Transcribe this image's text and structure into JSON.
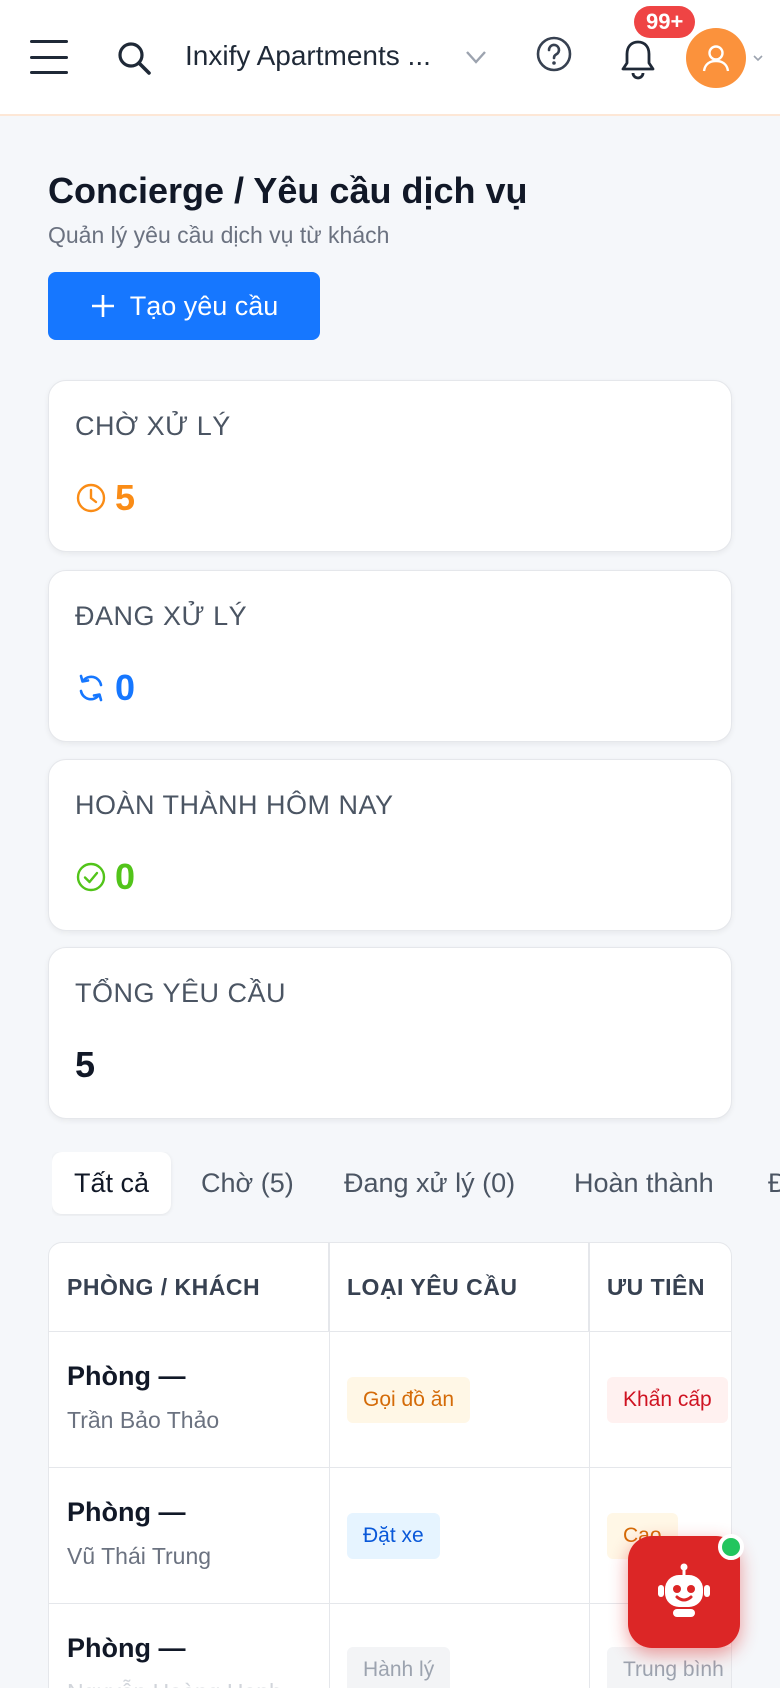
{
  "header": {
    "tenant_name": "Inxify Apartments ...",
    "notification_count": "99+"
  },
  "page": {
    "title": "Concierge / Yêu cầu dịch vụ",
    "subtitle": "Quản lý yêu cầu dịch vụ từ khách",
    "create_button_label": "Tạo yêu cầu"
  },
  "stats": [
    {
      "label": "CHỜ XỬ LÝ",
      "value": "5",
      "icon": "clock-icon",
      "color": "#fa8c16"
    },
    {
      "label": "ĐANG XỬ LÝ",
      "value": "0",
      "icon": "sync-icon",
      "color": "#1677ff"
    },
    {
      "label": "HOÀN THÀNH HÔM NAY",
      "value": "0",
      "icon": "check-circle-icon",
      "color": "#52c41a"
    },
    {
      "label": "TỔNG YÊU CẦU",
      "value": "5",
      "icon": "",
      "color": "#111827"
    }
  ],
  "tabs": [
    {
      "label": "Tất cả",
      "active": true
    },
    {
      "label": "Chờ (5)"
    },
    {
      "label": "Đang xử lý (0)"
    },
    {
      "label": "Hoàn thành"
    },
    {
      "label": "Đ"
    }
  ],
  "table": {
    "columns": [
      "PHÒNG / KHÁCH",
      "LOẠI YÊU CẦU",
      "ƯU TIÊN"
    ],
    "rows": [
      {
        "room": "Phòng —",
        "guest": "Trần Bảo Thảo",
        "type": "Gọi đồ ăn",
        "priority": "Khẩn cấp"
      },
      {
        "room": "Phòng —",
        "guest": "Vũ Thái Trung",
        "type": "Đặt xe",
        "priority": "Cao"
      },
      {
        "room": "Phòng —",
        "guest": "Nguyễn Hoàng Hạnh",
        "type": "Hành lý",
        "priority": "Trung bình"
      }
    ]
  },
  "colors": {
    "primary": "#1677ff",
    "danger": "#ef4444",
    "avatar": "#fb923c",
    "bot": "#dc2626",
    "online": "#22c55e"
  }
}
